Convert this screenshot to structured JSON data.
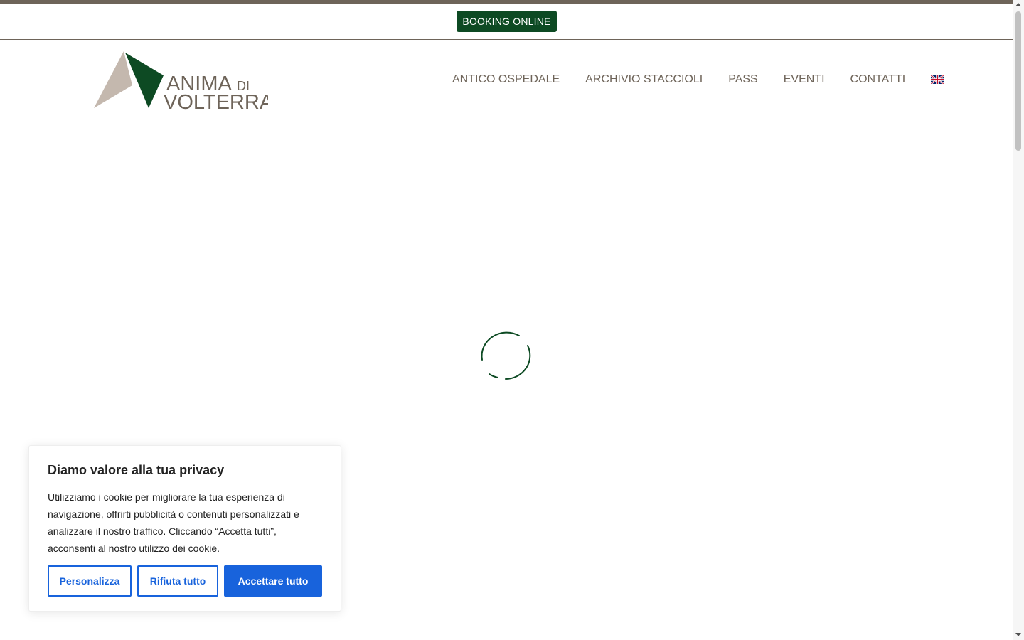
{
  "top_bar": {
    "booking_label": "BOOKING ONLINE"
  },
  "logo": {
    "line1": "ANIMA",
    "line1_small": "DI",
    "line2": "VOLTERRA"
  },
  "nav": {
    "items": [
      {
        "label": "ANTICO OSPEDALE"
      },
      {
        "label": "ARCHIVIO STACCIOLI"
      },
      {
        "label": "PASS"
      },
      {
        "label": "EVENTI"
      },
      {
        "label": "CONTATTI"
      }
    ],
    "language_icon": "uk-flag-icon"
  },
  "loader": {
    "icon": "loading-spinner-icon"
  },
  "cookie_banner": {
    "title": "Diamo valore alla tua privacy",
    "text": "Utilizziamo i cookie per migliorare la tua esperienza di navigazione, offrirti pubblicità o contenuti personalizzati e analizzare il nostro traffico. Cliccando “Accetta tutti”, acconsenti al nostro utilizzo dei cookie.",
    "customize_label": "Personalizza",
    "reject_label": "Rifiuta tutto",
    "accept_label": "Accettare tutto"
  },
  "colors": {
    "brand_green": "#0d4a23",
    "brand_taupe": "#6e6459",
    "logo_light": "#c4b8ae",
    "cookie_blue": "#1863dc"
  }
}
